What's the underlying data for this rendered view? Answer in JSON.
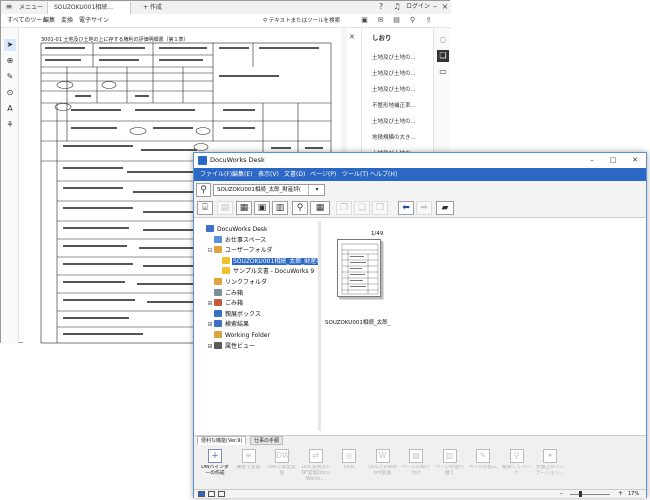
{
  "pdf": {
    "tabs": [
      {
        "label": "メニュー"
      },
      {
        "label": "SOUZOKU001相続..."
      },
      {
        "label": "+ 作成"
      }
    ],
    "menus": [
      "すべてのツール",
      "編集",
      "変換",
      "電子サイン"
    ],
    "search_label": "テキストまたはツールを検索",
    "login_label": "ログイン",
    "doc_title": "3001-01 土地及び土地の上に存する権利の評価明細書（第１表）",
    "bookmarks": {
      "title": "しおり",
      "items": [
        "土地及び土地の...",
        "土地及び土地の...",
        "土地及び土地の...",
        "不整形地補正率...",
        "土地及び土地の...",
        "地積規模の大き...",
        "土地及び土地の..."
      ]
    }
  },
  "dw": {
    "title": "DocuWorks Desk",
    "menus": [
      "ファイル(F)",
      "編集(E)",
      "表示(V)",
      "文書(D)",
      "ページ(P)",
      "ツール(T)",
      "ヘルプ(H)"
    ],
    "path": "SOUZOKU001相続_太郎_財産評(",
    "tree": [
      {
        "label": "DocuWorks Desk",
        "indent": 0,
        "exp": "",
        "color": "#3b6fc9",
        "selected": false
      },
      {
        "label": "お仕事スペース",
        "indent": 1,
        "exp": "",
        "color": "#5a8fd6",
        "selected": false
      },
      {
        "label": "ユーザーフォルダ",
        "indent": 1,
        "exp": "⊟",
        "color": "#e0a23a",
        "selected": false
      },
      {
        "label": "SOUZOKU001相続_太郎_財産評価K",
        "indent": 2,
        "exp": "",
        "color": "#f2c02a",
        "selected": true
      },
      {
        "label": "サンプル文書 - DocuWorks 9",
        "indent": 2,
        "exp": "",
        "color": "#f2c02a",
        "selected": false
      },
      {
        "label": "リンクフォルダ",
        "indent": 1,
        "exp": "",
        "color": "#e0a23a",
        "selected": false
      },
      {
        "label": "ごみ箱",
        "indent": 1,
        "exp": "",
        "color": "#7f8c99",
        "selected": false
      },
      {
        "label": "ごみ箱",
        "indent": 1,
        "exp": "⊞",
        "color": "#c45a3a",
        "selected": false
      },
      {
        "label": "親展ボックス",
        "indent": 1,
        "exp": "",
        "color": "#3a6fc4",
        "selected": false
      },
      {
        "label": "検索結果",
        "indent": 1,
        "exp": "⊞",
        "color": "#3a6fc4",
        "selected": false
      },
      {
        "label": "Working Folder",
        "indent": 1,
        "exp": "",
        "color": "#d9a441",
        "selected": false
      },
      {
        "label": "属性ビュー",
        "indent": 1,
        "exp": "⊞",
        "color": "#5b5b5b",
        "selected": false
      }
    ],
    "page_count": "1/49",
    "thumb_label": "SOUZOKU001相続_太郎_",
    "bottom_tabs": [
      "便利な機能(Ver.9)",
      "仕事の手順"
    ],
    "bottom_buttons": [
      {
        "label": "DWバインダーの作成",
        "icon": "＋",
        "enabled": true
      },
      {
        "label": "属性で変換",
        "icon": "≡",
        "enabled": false
      },
      {
        "label": "DWで高位変換",
        "icon": "DW",
        "enabled": false
      },
      {
        "label": "DOC形式をPDF変換DocuWorks...",
        "icon": "⇄",
        "enabled": false
      },
      {
        "label": "OCR",
        "icon": "◎",
        "enabled": false
      },
      {
        "label": "DOCとDWWord変換",
        "icon": "W",
        "enabled": false
      },
      {
        "label": "ページの取り付け",
        "icon": "▤",
        "enabled": false
      },
      {
        "label": "ページの並べ替え",
        "icon": "▥",
        "enabled": false
      },
      {
        "label": "ページの加工",
        "icon": "✎",
        "enabled": false
      },
      {
        "label": "検索してマーク",
        "icon": "⚲",
        "enabled": false
      },
      {
        "label": "文書上のアノテーション...",
        "icon": "✦",
        "enabled": false
      }
    ],
    "zoom": "17%"
  }
}
